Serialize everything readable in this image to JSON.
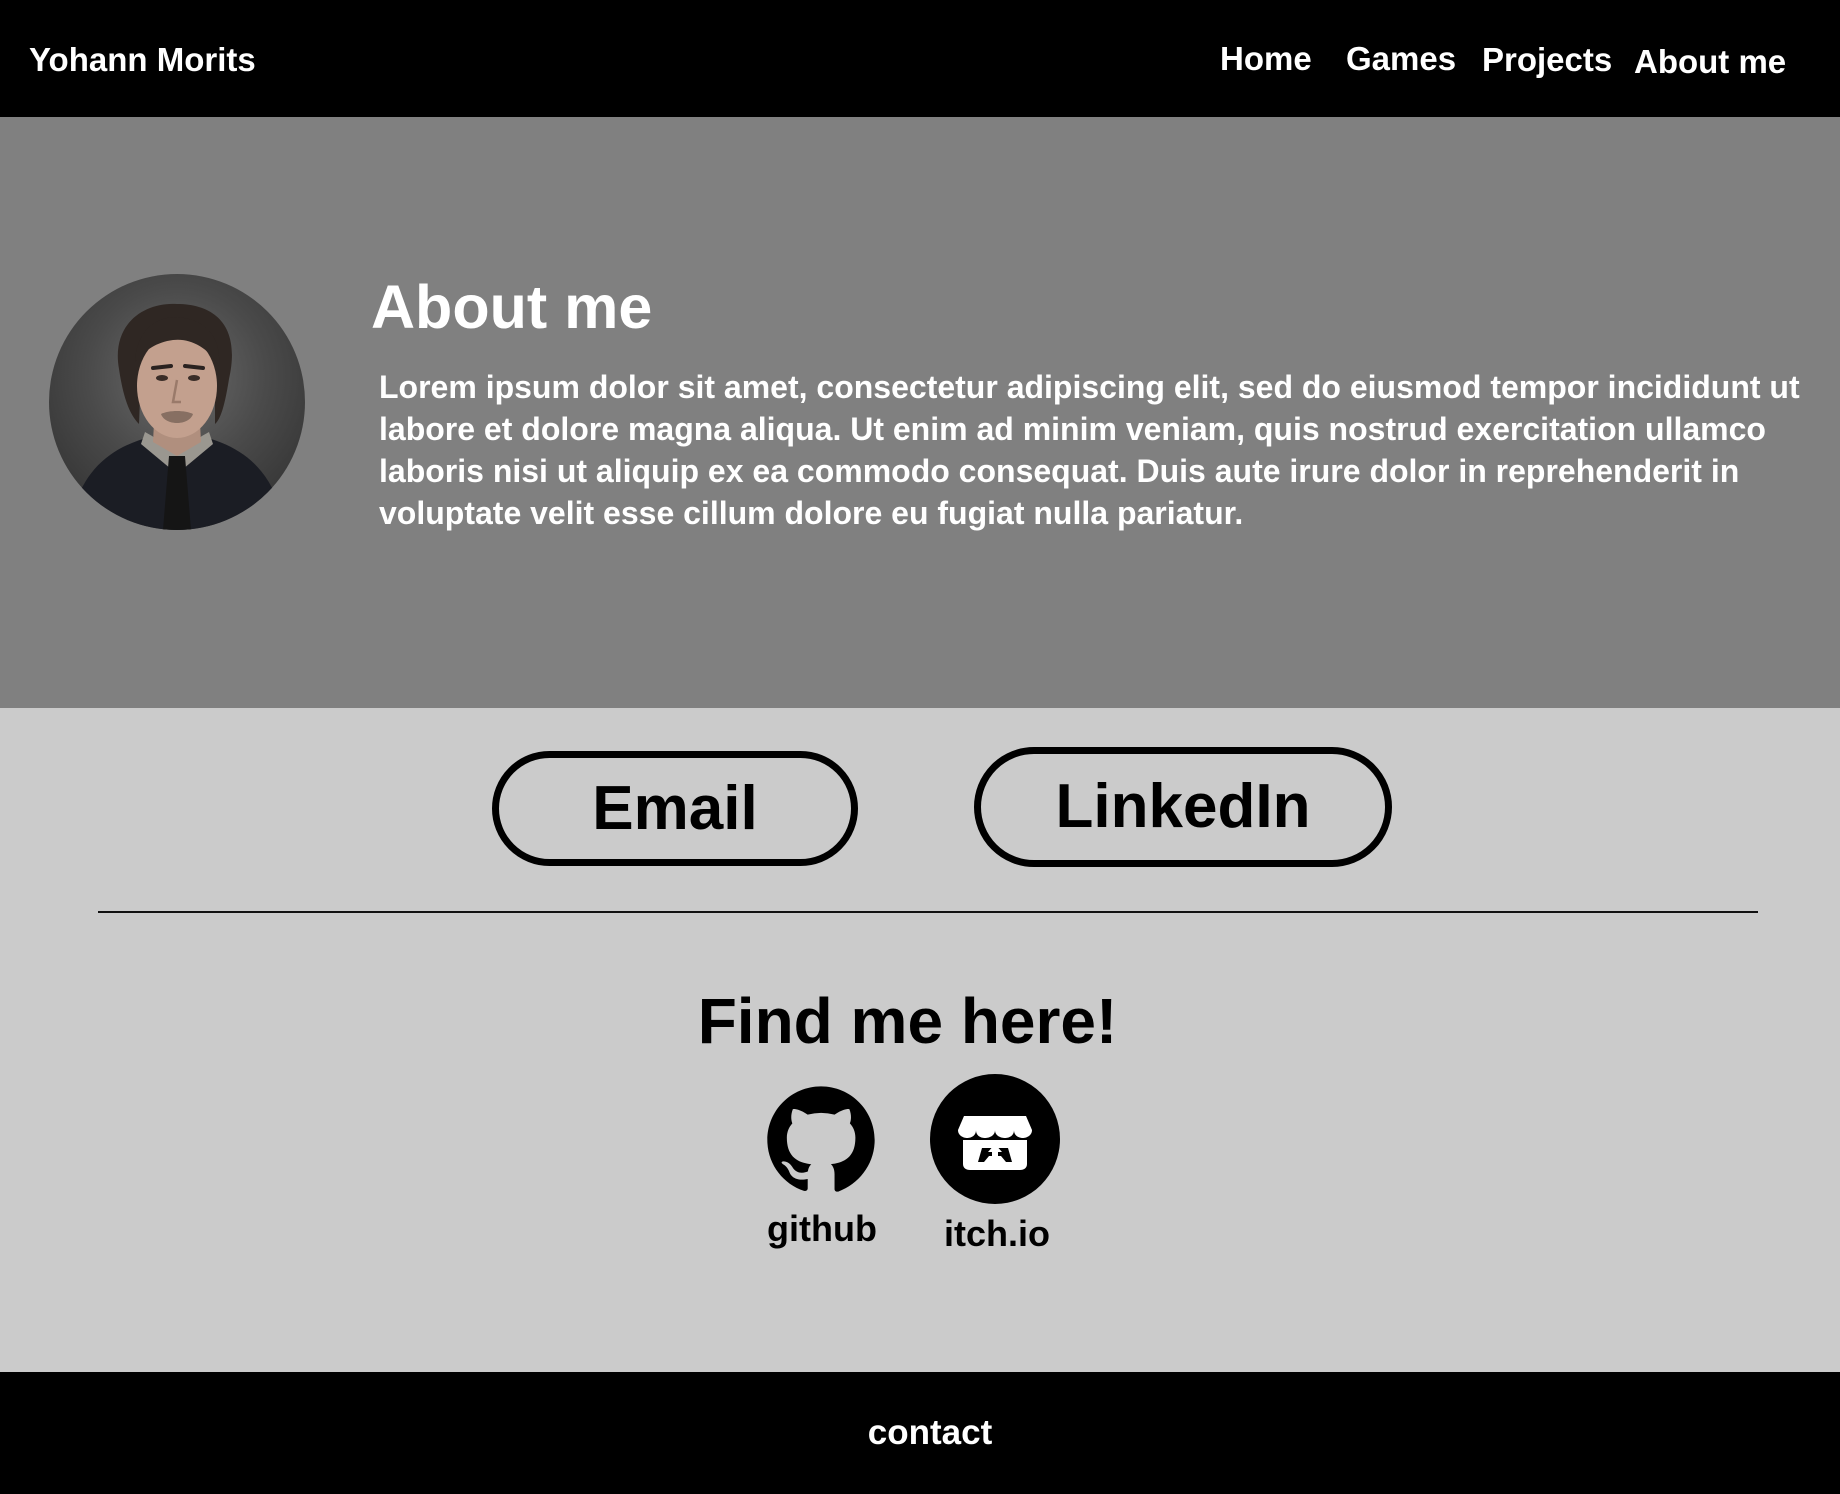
{
  "header": {
    "brand": "Yohann Morits",
    "nav": {
      "home": "Home",
      "games": "Games",
      "projects": "Projects",
      "about": "About me"
    }
  },
  "hero": {
    "title": "About me",
    "body": "Lorem ipsum dolor sit amet, consectetur adipiscing elit, sed do eiusmod tempor incididunt ut labore et dolore magna aliqua. Ut enim ad minim veniam, quis nostrud exercitation ullamco laboris nisi ut aliquip ex ea commodo consequat. Duis aute irure dolor in reprehenderit in voluptate velit esse cillum dolore eu fugiat nulla pariatur."
  },
  "contact_buttons": {
    "email": "Email",
    "linkedin": "LinkedIn"
  },
  "find_me": {
    "title": "Find me here!",
    "links": {
      "github": {
        "label": "github",
        "icon": "github-icon"
      },
      "itch": {
        "label": "itch.io",
        "icon": "itch-io-icon"
      }
    }
  },
  "footer": {
    "link": "contact"
  },
  "colors": {
    "navbar": "#000000",
    "hero": "#808080",
    "section": "#cbcbcb",
    "text_light": "#ffffff",
    "text_dark": "#000000"
  }
}
